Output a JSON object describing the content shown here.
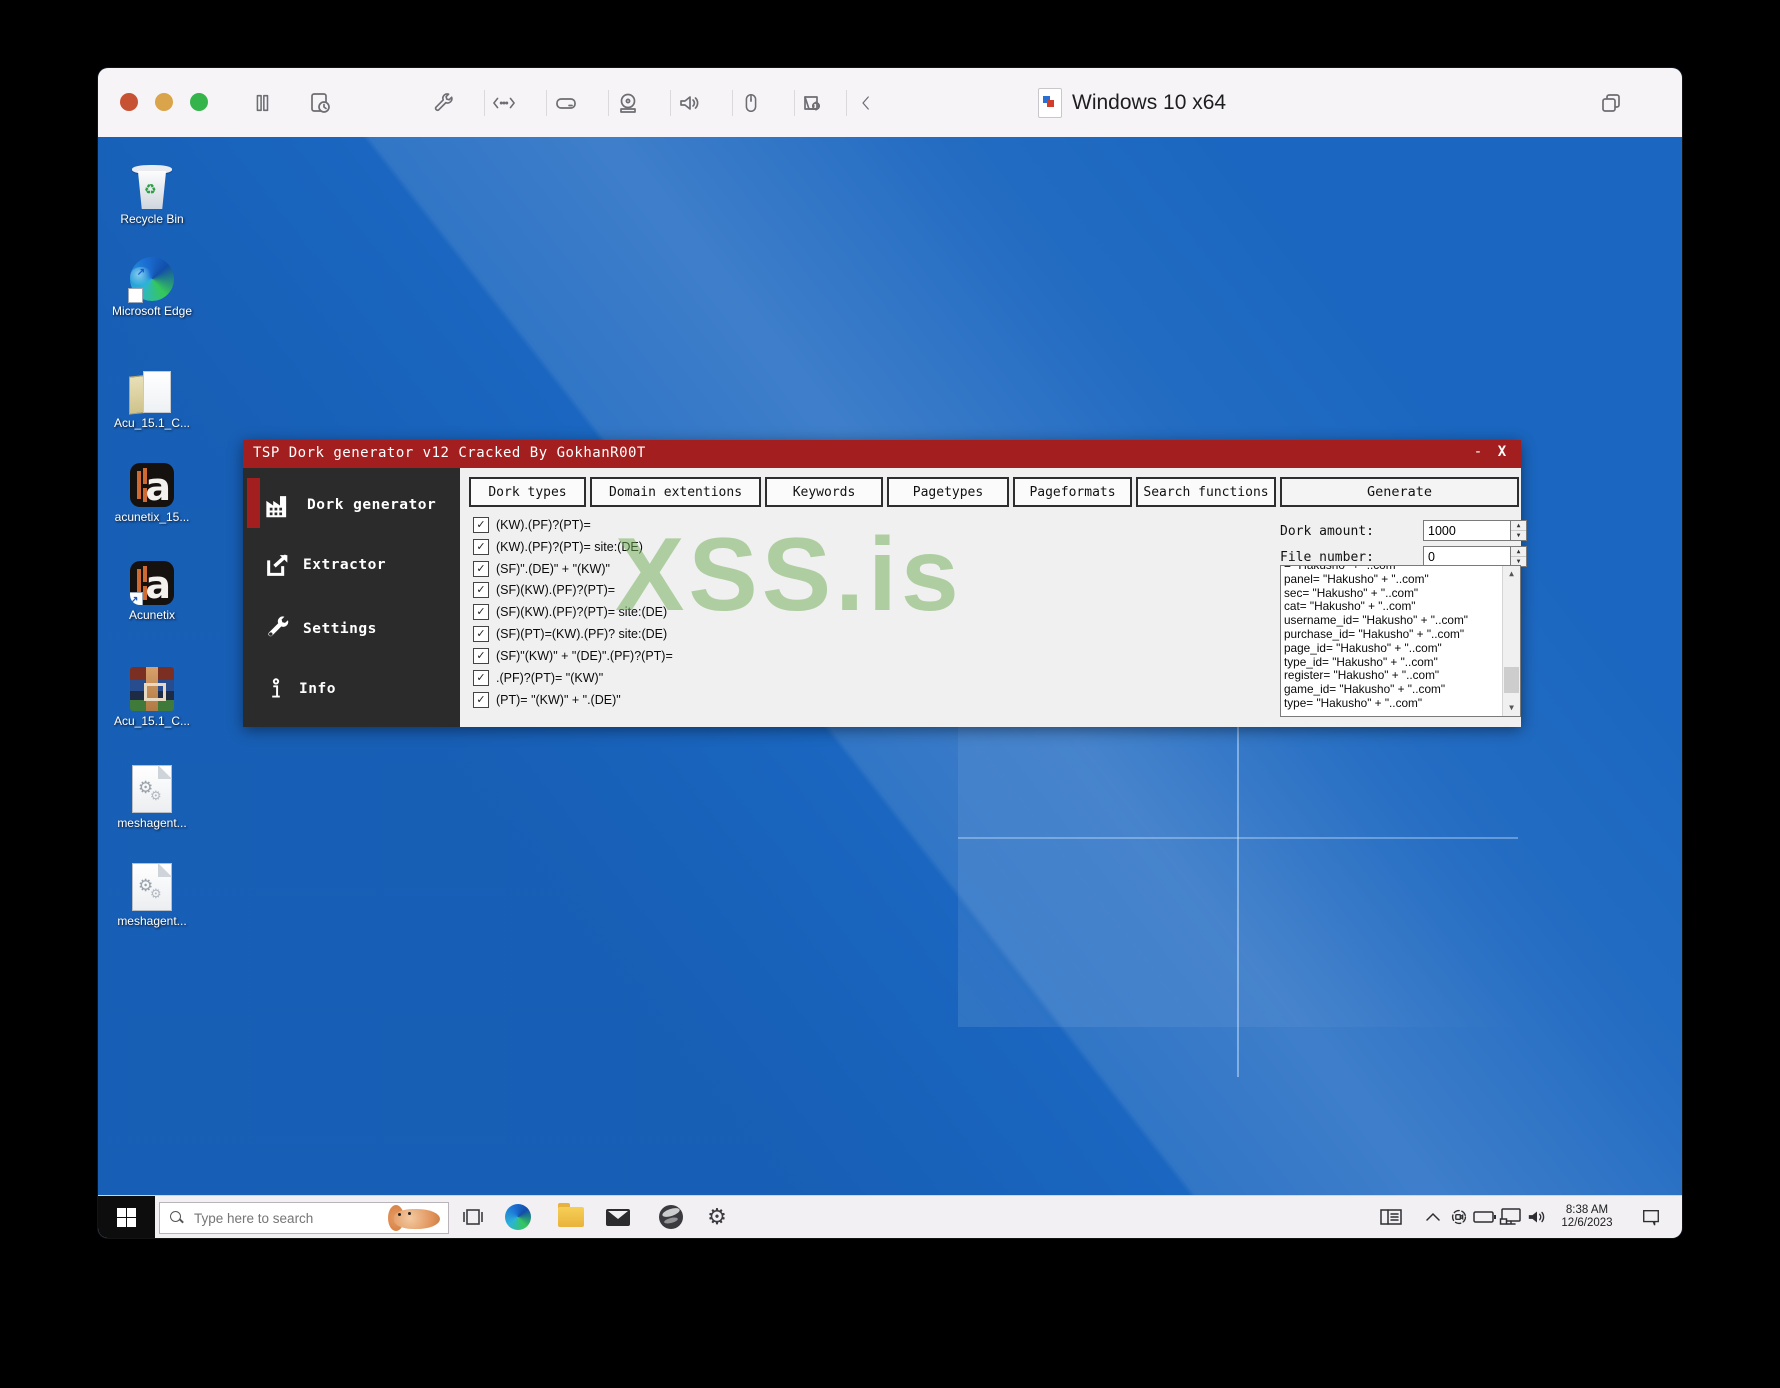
{
  "vm": {
    "window_title": "Windows 10 x64",
    "toolbar_icons": [
      "pause-icon",
      "snapshot-icon",
      "wrench-icon",
      "network-icon",
      "harddisk-icon",
      "cdrom-icon",
      "sound-icon",
      "mouse-icon",
      "usb-settings-icon",
      "collapse-toolbar-icon",
      "show-all-windows-icon"
    ]
  },
  "desktop": {
    "icons": [
      {
        "label": "Recycle Bin"
      },
      {
        "label": "Microsoft Edge"
      },
      {
        "label": "Acu_15.1_C..."
      },
      {
        "label": "acunetix_15..."
      },
      {
        "label": "Acunetix"
      },
      {
        "label": "Acu_15.1_C..."
      },
      {
        "label": "meshagent..."
      },
      {
        "label": "meshagent..."
      }
    ]
  },
  "app": {
    "title": "TSP Dork generator v12 Cracked By GokhanR00T",
    "minimize_label": "-",
    "close_label": "X",
    "watermark": "XSS.is",
    "sidebar": {
      "items": [
        {
          "label": "Dork generator",
          "icon": "factory-icon"
        },
        {
          "label": "Extractor",
          "icon": "export-icon"
        },
        {
          "label": "Settings",
          "icon": "wrench-icon"
        },
        {
          "label": "Info",
          "icon": "info-icon"
        }
      ]
    },
    "tabs": [
      {
        "label": "Dork types"
      },
      {
        "label": "Domain extentions"
      },
      {
        "label": "Keywords"
      },
      {
        "label": "Pagetypes"
      },
      {
        "label": "Pageformats"
      },
      {
        "label": "Search functions"
      }
    ],
    "generate_label": "Generate",
    "fields": {
      "dork_amount_label": "Dork amount:",
      "dork_amount_value": "1000",
      "file_number_label": "File number:",
      "file_number_value": "0"
    },
    "patterns": [
      {
        "label": "(KW).(PF)?(PT)=",
        "checked": true
      },
      {
        "label": "(KW).(PF)?(PT)= site:(DE)",
        "checked": true
      },
      {
        "label": "(SF)\".(DE)\" + \"(KW)\"",
        "checked": true
      },
      {
        "label": "(SF)(KW).(PF)?(PT)=",
        "checked": true
      },
      {
        "label": "(SF)(KW).(PF)?(PT)= site:(DE)",
        "checked": true
      },
      {
        "label": "(SF)(PT)=(KW).(PF)? site:(DE)",
        "checked": true
      },
      {
        "label": "(SF)\"(KW)\" + \"(DE)\".(PF)?(PT)=",
        "checked": true
      },
      {
        "label": ".(PF)?(PT)= \"(KW)\"",
        "checked": true
      },
      {
        "label": "(PT)= \"(KW)\" + \".(DE)\"",
        "checked": true
      }
    ],
    "results": {
      "partial_top": "= \"Hakusho\" + \"..com\"",
      "lines": [
        "panel= \"Hakusho\" + \"..com\"",
        "sec= \"Hakusho\" + \"..com\"",
        "cat= \"Hakusho\" + \"..com\"",
        "username_id= \"Hakusho\" + \"..com\"",
        "purchase_id= \"Hakusho\" + \"..com\"",
        "page_id= \"Hakusho\" + \"..com\"",
        "type_id= \"Hakusho\" + \"..com\"",
        "register= \"Hakusho\" + \"..com\"",
        "game_id= \"Hakusho\" + \"..com\"",
        "type= \"Hakusho\" + \"..com\""
      ]
    }
  },
  "taskbar": {
    "search_placeholder": "Type here to search",
    "clock": {
      "time": "8:38 AM",
      "date": "12/6/2023"
    }
  },
  "colors": {
    "titlebar_red": "#a31f1f",
    "sidebar_dark": "#2b2b2b",
    "watermark_green": "#6fae54",
    "desktop_blue": "#1a66c0"
  }
}
